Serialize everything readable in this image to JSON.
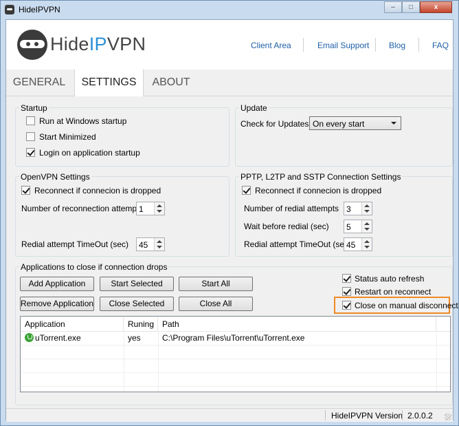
{
  "window": {
    "title": "HideIPVPN",
    "min_label": "–",
    "max_label": "□",
    "close_label": "x"
  },
  "header": {
    "logo": {
      "text_main": "Hide",
      "text_accent": "IP",
      "text_end": "VPN"
    },
    "links": [
      "Client Area",
      "Email Support",
      "Blog",
      "FAQ"
    ]
  },
  "tabs": [
    {
      "label": "GENERAL",
      "active": false
    },
    {
      "label": "SETTINGS",
      "active": true
    },
    {
      "label": "ABOUT",
      "active": false
    }
  ],
  "startup": {
    "title": "Startup",
    "options": [
      {
        "label": "Run at Windows startup",
        "checked": false
      },
      {
        "label": "Start Minimized",
        "checked": false
      },
      {
        "label": "Login on application startup",
        "checked": true
      }
    ]
  },
  "update": {
    "title": "Update",
    "check_label": "Check for Updates",
    "selected": "On every start"
  },
  "openvpn": {
    "title": "OpenVPN Settings",
    "reconnect": {
      "label": "Reconnect if connecion is dropped",
      "checked": true
    },
    "attempts": {
      "label": "Number of reconnection attempts",
      "value": "1"
    },
    "timeout": {
      "label": "Redial attempt TimeOut (sec)",
      "value": "45"
    }
  },
  "pptp": {
    "title": "PPTP, L2TP and SSTP Connection Settings",
    "reconnect": {
      "label": "Reconnect if connecion is dropped",
      "checked": true
    },
    "attempts": {
      "label": "Number of redial attempts",
      "value": "3"
    },
    "wait": {
      "label": "Wait before redial (sec)",
      "value": "5"
    },
    "timeout": {
      "label": "Redial attempt TimeOut (sec)",
      "value": "45"
    }
  },
  "apps": {
    "title": "Applications to close if connection drops",
    "buttons": {
      "add": "Add Application",
      "start_selected": "Start Selected",
      "start_all": "Start All",
      "remove": "Remove Application",
      "close_selected": "Close Selected",
      "close_all": "Close All"
    },
    "options": [
      {
        "label": "Status auto refresh",
        "checked": true
      },
      {
        "label": "Restart on reconnect",
        "checked": true
      },
      {
        "label": "Close on manual disconnect",
        "checked": true
      }
    ],
    "highlight_color": "#f08a24",
    "table": {
      "columns": [
        "Application",
        "Runing",
        "Path"
      ],
      "rows": [
        {
          "app": "uTorrent.exe",
          "icon": "utorrent-icon",
          "running": "yes",
          "path": "C:\\Program Files\\uTorrent\\uTorrent.exe"
        }
      ]
    }
  },
  "status": {
    "version_label": "HideIPVPN Version",
    "version": "2.0.0.2"
  },
  "colors": {
    "link": "#1d5fa8",
    "logo_accent": "#2b8fd6",
    "titlebar": "#c9dbee"
  }
}
